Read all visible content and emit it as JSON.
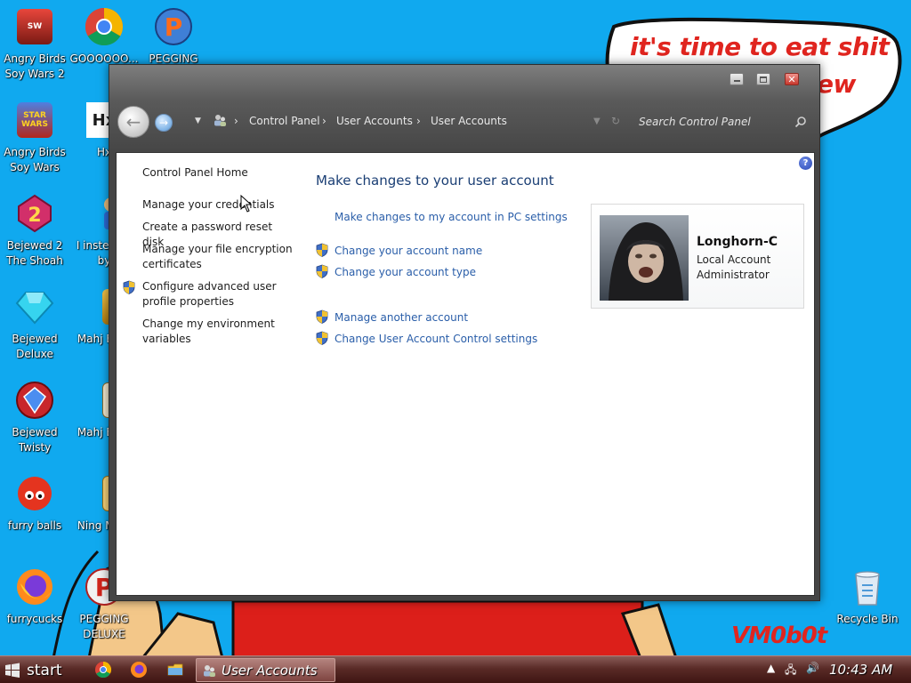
{
  "desktop": {
    "icons": [
      {
        "label": "Angry Birds Soy Wars 2",
        "icon": "angry-birds-star-wars-2-icon"
      },
      {
        "label": "GOOOOOO...",
        "icon": "chrome-icon"
      },
      {
        "label": "PEGGING",
        "icon": "pegging-icon"
      },
      {
        "label": "Angry Birds Soy Wars",
        "icon": "angry-birds-star-wars-icon"
      },
      {
        "label": "Hx",
        "icon": "hx-icon"
      },
      {
        "label": "Bejewed 2 The Shoah",
        "icon": "bejeweled-2-icon"
      },
      {
        "label": "I inste this by",
        "icon": "installer-icon"
      },
      {
        "label": "Bejewed Deluxe",
        "icon": "bejeweled-deluxe-icon"
      },
      {
        "label": "Mahj Esca",
        "icon": "mahjong-escape-icon"
      },
      {
        "label": "Bejewed Twisty",
        "icon": "bejeweled-twist-icon"
      },
      {
        "label": "Mahj Esca",
        "icon": "mahjong-escape-2-icon"
      },
      {
        "label": "furry balls",
        "icon": "furry-balls-icon"
      },
      {
        "label": "Ning MahJ",
        "icon": "ninja-mahjong-icon"
      },
      {
        "label": "furrycucks",
        "icon": "firefox-icon"
      },
      {
        "label": "PEGGING DELUXE",
        "icon": "pegging-deluxe-icon"
      },
      {
        "label": "Recycle Bin",
        "icon": "recycle-bin-icon"
      }
    ],
    "wallpaper_text_1": "it's time to eat shit",
    "wallpaper_text_2": "ew",
    "wallpaper_tag": "VM0b0t"
  },
  "window": {
    "title": "User Accounts",
    "address": {
      "crumbs": [
        "Control Panel",
        "User Accounts",
        "User Accounts"
      ],
      "separator": "›"
    },
    "search_placeholder": "Search Control Panel",
    "sidebar": {
      "items": [
        "Control Panel Home",
        "Manage your credentials",
        "Create a password reset disk",
        "Manage your file encryption certificates",
        "Configure advanced user profile properties",
        "Change my environment variables"
      ]
    },
    "main": {
      "title": "Make changes to your user account",
      "links": [
        "Make changes to my account in PC settings",
        "Change your account name",
        "Change your account type",
        "Manage another account",
        "Change User Account Control settings"
      ]
    },
    "account": {
      "name": "Longhorn-C",
      "type": "Local Account",
      "role": "Administrator"
    }
  },
  "taskbar": {
    "start_label": "start",
    "task_label": "User Accounts",
    "clock": "10:43 AM"
  },
  "colors": {
    "desktop_bg": "#10a9ef",
    "link": "#2a5ea9",
    "title": "#1a3e74",
    "taskbar": "#5a2b27"
  }
}
